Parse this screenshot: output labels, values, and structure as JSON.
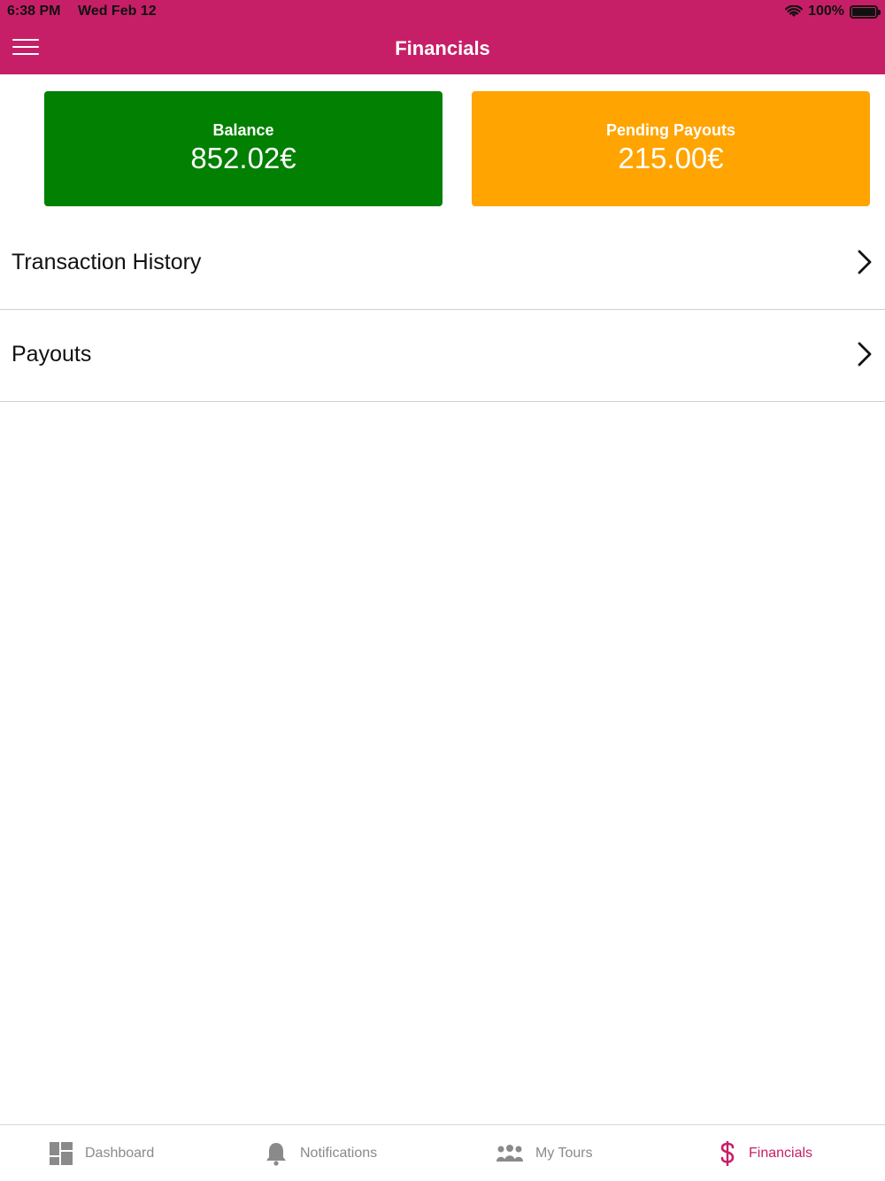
{
  "status_bar": {
    "time": "6:38 PM",
    "date": "Wed Feb 12",
    "battery": "100%"
  },
  "header": {
    "title": "Financials",
    "menu_icon": "hamburger-icon"
  },
  "cards": {
    "balance": {
      "label": "Balance",
      "value": "852.02€",
      "color": "#018001"
    },
    "pending": {
      "label": "Pending Payouts",
      "value": "215.00€",
      "color": "#ffa400"
    }
  },
  "list": {
    "items": [
      {
        "label": "Transaction History",
        "icon": "chevron-right-icon"
      },
      {
        "label": "Payouts",
        "icon": "chevron-right-icon"
      }
    ]
  },
  "tabbar": {
    "tabs": [
      {
        "label": "Dashboard",
        "icon": "dashboard-icon"
      },
      {
        "label": "Notifications",
        "icon": "bell-icon"
      },
      {
        "label": "My Tours",
        "icon": "group-icon"
      },
      {
        "label": "Financials",
        "icon": "dollar-icon",
        "active": true
      }
    ]
  },
  "colors": {
    "brand": "#c71f67",
    "inactive_tab": "#8a8a8a"
  }
}
